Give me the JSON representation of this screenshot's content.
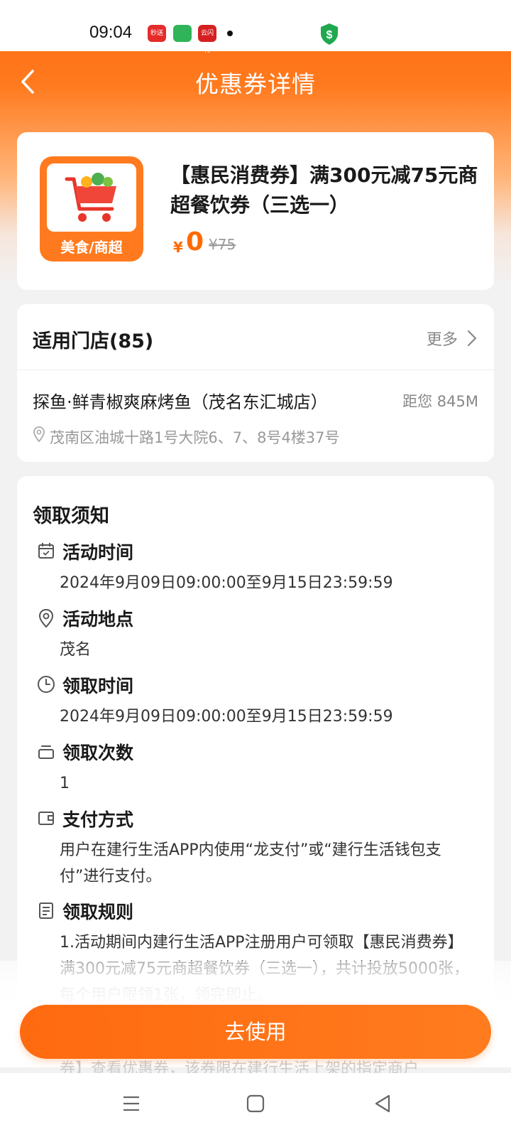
{
  "status_bar": {
    "time": "09:04",
    "app_icons": [
      "秒送",
      "",
      "云闪付"
    ]
  },
  "header": {
    "title": "优惠券详情"
  },
  "coupon": {
    "category_label": "美食/商超",
    "title": "【惠民消费券】满300元减75元商超餐饮券（三选一）",
    "currency": "¥",
    "price": "0",
    "original_price": "¥75",
    "accent_color": "#ff6a00"
  },
  "stores": {
    "title": "适用门店(85)",
    "more_label": "更多",
    "store_name": "探鱼·鲜青椒爽麻烤鱼（茂名东汇城店）",
    "distance": "距您 845M",
    "address": "茂南区油城十路1号大院6、7、8号4楼37号"
  },
  "notice": {
    "title": "领取须知",
    "sections": [
      {
        "icon": "calendar-icon",
        "title": "活动时间",
        "body": "2024年9月09日09:00:00至9月15日23:59:59"
      },
      {
        "icon": "location-pin-icon",
        "title": "活动地点",
        "body": "茂名"
      },
      {
        "icon": "clock-icon",
        "title": "领取时间",
        "body": "2024年9月09日09:00:00至9月15日23:59:59"
      },
      {
        "icon": "stack-icon",
        "title": "领取次数",
        "body": "1"
      },
      {
        "icon": "wallet-icon",
        "title": "支付方式",
        "body": "用户在建行生活APP内使用“龙支付”或“建行生活钱包支付”进行支付。"
      },
      {
        "icon": "document-icon",
        "title": "领取规则",
        "body": "1.活动期间内建行生活APP注册用户可领取【惠民消费券】满300元减75元商超餐饮券（三选一），共计投放5000张，每个用户限领1张，领完即止。"
      }
    ],
    "faded_text": "券】查看优惠券，该券限在建行生活上架的指定商户"
  },
  "actions": {
    "use_label": "去使用"
  }
}
